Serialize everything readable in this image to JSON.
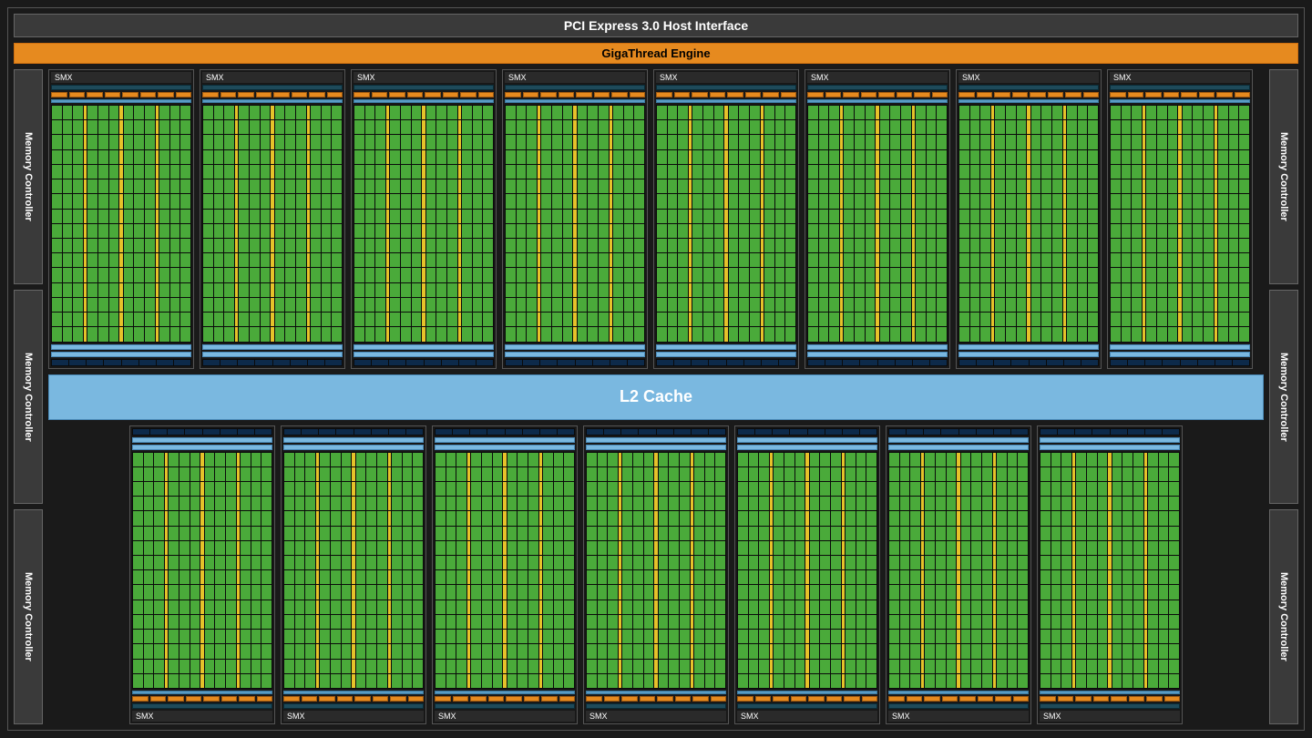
{
  "labels": {
    "pci": "PCI Express 3.0 Host Interface",
    "gte": "GigaThread Engine",
    "l2": "L2 Cache",
    "mem": "Memory Controller",
    "smx": "SMX"
  },
  "architecture": {
    "smx_top_count": 8,
    "smx_bottom_count": 7,
    "memory_controllers_per_side": 3,
    "core_rows": 16,
    "core_pattern_per_row": "3 green, 1 yellow, 3 green, 1 yellow, 3 green, 1 yellow, 3 green",
    "dispatch_units": 8,
    "tex_units": 8
  },
  "colors": {
    "core_green": "#4aaa3a",
    "sfu_yellow": "#e6c22a",
    "scheduler_teal": "#1e4a5a",
    "dispatch_orange": "#e68a1f",
    "cache_blue": "#7ab8e0",
    "tex_navy": "#0d2a4a",
    "frame_gray": "#3a3a3a",
    "bg": "#1a1a1a"
  }
}
